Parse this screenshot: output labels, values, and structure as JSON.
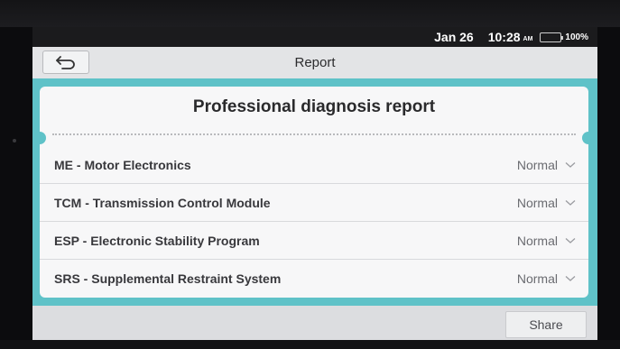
{
  "status_bar": {
    "date": "Jan 26",
    "time": "10:28",
    "ampm": "AM",
    "battery_percent": "100%",
    "battery_color": "#36d43e"
  },
  "header": {
    "back_icon": "back-arrow-icon",
    "title": "Report"
  },
  "report": {
    "title": "Professional diagnosis report",
    "accent": "#5fc2c8",
    "systems": [
      {
        "name": "ME - Motor Electronics",
        "status": "Normal"
      },
      {
        "name": "TCM - Transmission Control Module",
        "status": "Normal"
      },
      {
        "name": "ESP - Electronic Stability Program",
        "status": "Normal"
      },
      {
        "name": "SRS - Supplemental Restraint System",
        "status": "Normal"
      }
    ]
  },
  "actions": {
    "share_label": "Share"
  }
}
